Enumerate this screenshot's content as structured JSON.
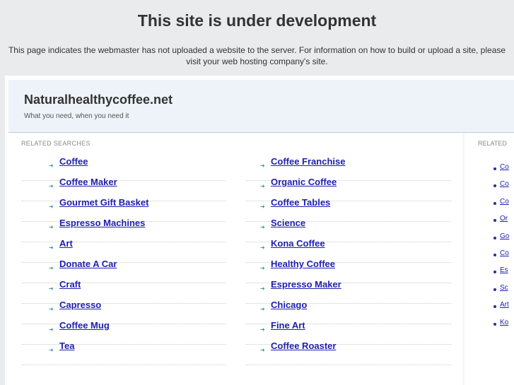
{
  "page": {
    "heading": "This site is under development",
    "notice": "This page indicates the webmaster has not uploaded a website to the server. For information on how to build or upload a site, please visit your web hosting company's site."
  },
  "site": {
    "name": "Naturalhealthycoffee.net",
    "tagline": "What you need, when you need it"
  },
  "related": {
    "label": "RELATED SEARCHES",
    "left": [
      "Coffee",
      "Coffee Maker",
      "Gourmet Gift Basket",
      "Espresso Machines",
      "Art",
      "Donate A Car",
      "Craft",
      "Capresso",
      "Coffee Mug",
      "Tea"
    ],
    "right": [
      "Coffee Franchise",
      "Organic Coffee",
      "Coffee Tables",
      "Science",
      "Kona Coffee",
      "Healthy Coffee",
      "Espresso Maker",
      "Chicago",
      "Fine Art",
      "Coffee Roaster"
    ]
  },
  "sidebar": {
    "label": "RELATED",
    "items": [
      "Co",
      "Co",
      "Co",
      "Or",
      "Go",
      "Co",
      "Es",
      "Sc",
      "Art",
      "Ko"
    ]
  }
}
